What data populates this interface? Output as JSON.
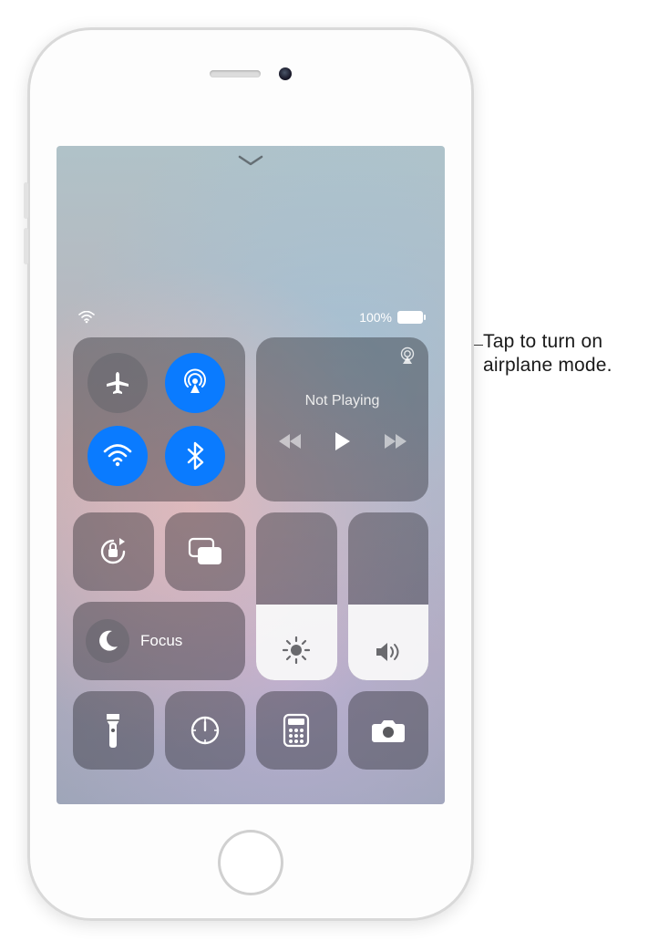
{
  "callout": {
    "text": "Tap to turn on airplane mode."
  },
  "status": {
    "wifi_icon": "wifi",
    "battery_pct": "100%"
  },
  "connectivity": {
    "airplane": {
      "active": false,
      "icon": "airplane"
    },
    "airdrop": {
      "active": true,
      "icon": "airdrop"
    },
    "wifi": {
      "active": true,
      "icon": "wifi"
    },
    "bluetooth": {
      "active": true,
      "icon": "bluetooth"
    }
  },
  "media": {
    "title": "Not Playing",
    "airplay_icon": "airplay",
    "prev_icon": "backward",
    "play_icon": "play",
    "next_icon": "forward"
  },
  "modules": {
    "orientation_lock": {
      "icon": "orientation-lock"
    },
    "screen_mirroring": {
      "icon": "screen-mirror"
    },
    "focus": {
      "icon": "moon",
      "label": "Focus"
    },
    "brightness": {
      "icon": "brightness",
      "level_pct": 45
    },
    "volume": {
      "icon": "volume",
      "level_pct": 45
    },
    "flashlight": {
      "icon": "flashlight"
    },
    "timer": {
      "icon": "timer"
    },
    "calculator": {
      "icon": "calculator"
    },
    "camera": {
      "icon": "camera"
    }
  }
}
